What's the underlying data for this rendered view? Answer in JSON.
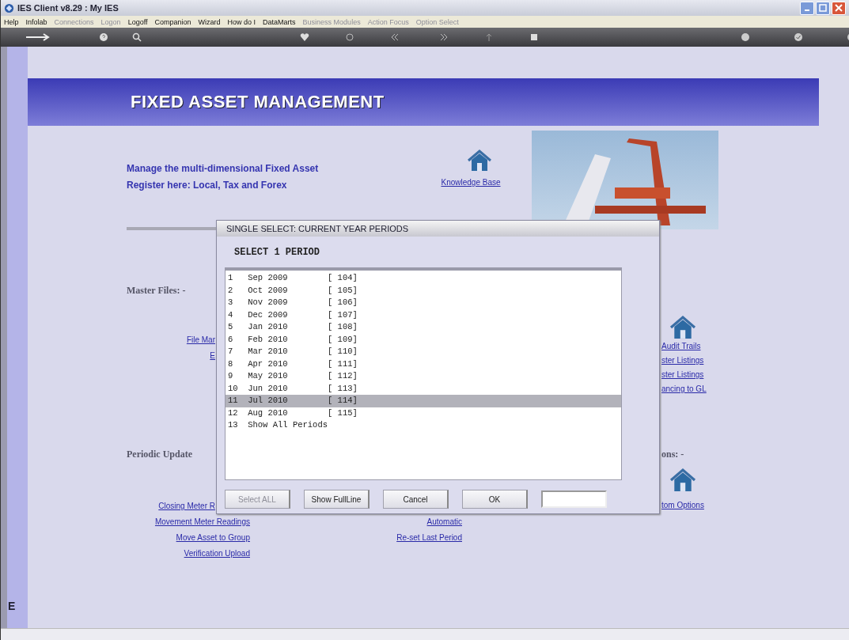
{
  "window": {
    "title": "IES Client v8.29 : My IES"
  },
  "menu": [
    {
      "label": "Help",
      "disabled": false
    },
    {
      "label": "Infolab",
      "disabled": false
    },
    {
      "label": "Connections",
      "disabled": true
    },
    {
      "label": "Logon",
      "disabled": true
    },
    {
      "label": "Logoff",
      "disabled": false
    },
    {
      "label": "Companion",
      "disabled": false
    },
    {
      "label": "Wizard",
      "disabled": false
    },
    {
      "label": "How do I",
      "disabled": false
    },
    {
      "label": "DataMarts",
      "disabled": false
    },
    {
      "label": "Business Modules",
      "disabled": true
    },
    {
      "label": "Action Focus",
      "disabled": true
    },
    {
      "label": "Option Select",
      "disabled": true
    }
  ],
  "banner": {
    "title": "FIXED ASSET MANAGEMENT"
  },
  "intro": "Manage the multi-dimensional Fixed Asset Register here: Local, Tax and Forex",
  "knowledge_base": {
    "label": "Knowledge Base"
  },
  "master_files": {
    "heading": "Master Files: -",
    "left_links": [
      "File Mar",
      "E"
    ],
    "right_links": [
      "Audit Trails",
      "ster Listings",
      "ster Listings",
      "ancing to GL"
    ]
  },
  "periodic_updates": {
    "heading": "Periodic Update",
    "right_heading": "ons: -",
    "left_links": [
      "Closing Meter R",
      "Movement Meter Readings",
      "Move Asset to Group",
      "Verification Upload"
    ],
    "middle_links": [
      "Automatic",
      "Re-set Last Period"
    ],
    "right_links": [
      "tom Options"
    ]
  },
  "dialog": {
    "title": "SINGLE SELECT: CURRENT YEAR PERIODS",
    "prompt": "SELECT 1 PERIOD",
    "rows": [
      {
        "text": "1   Sep 2009        [ 104]",
        "selected": false
      },
      {
        "text": "2   Oct 2009        [ 105]",
        "selected": false
      },
      {
        "text": "3   Nov 2009        [ 106]",
        "selected": false
      },
      {
        "text": "4   Dec 2009        [ 107]",
        "selected": false
      },
      {
        "text": "5   Jan 2010        [ 108]",
        "selected": false
      },
      {
        "text": "6   Feb 2010        [ 109]",
        "selected": false
      },
      {
        "text": "7   Mar 2010        [ 110]",
        "selected": false
      },
      {
        "text": "8   Apr 2010        [ 111]",
        "selected": false
      },
      {
        "text": "9   May 2010        [ 112]",
        "selected": false
      },
      {
        "text": "10  Jun 2010        [ 113]",
        "selected": false
      },
      {
        "text": "11  Jul 2010        [ 114]",
        "selected": true
      },
      {
        "text": "12  Aug 2010        [ 115]",
        "selected": false
      },
      {
        "text": "13  Show All Periods",
        "selected": false
      }
    ],
    "buttons": [
      {
        "label": "Select ALL",
        "disabled": true
      },
      {
        "label": "Show FullLine",
        "disabled": false
      },
      {
        "label": "Cancel",
        "disabled": false
      },
      {
        "label": "OK",
        "disabled": false
      }
    ]
  },
  "sidebar": {
    "label": "E"
  }
}
